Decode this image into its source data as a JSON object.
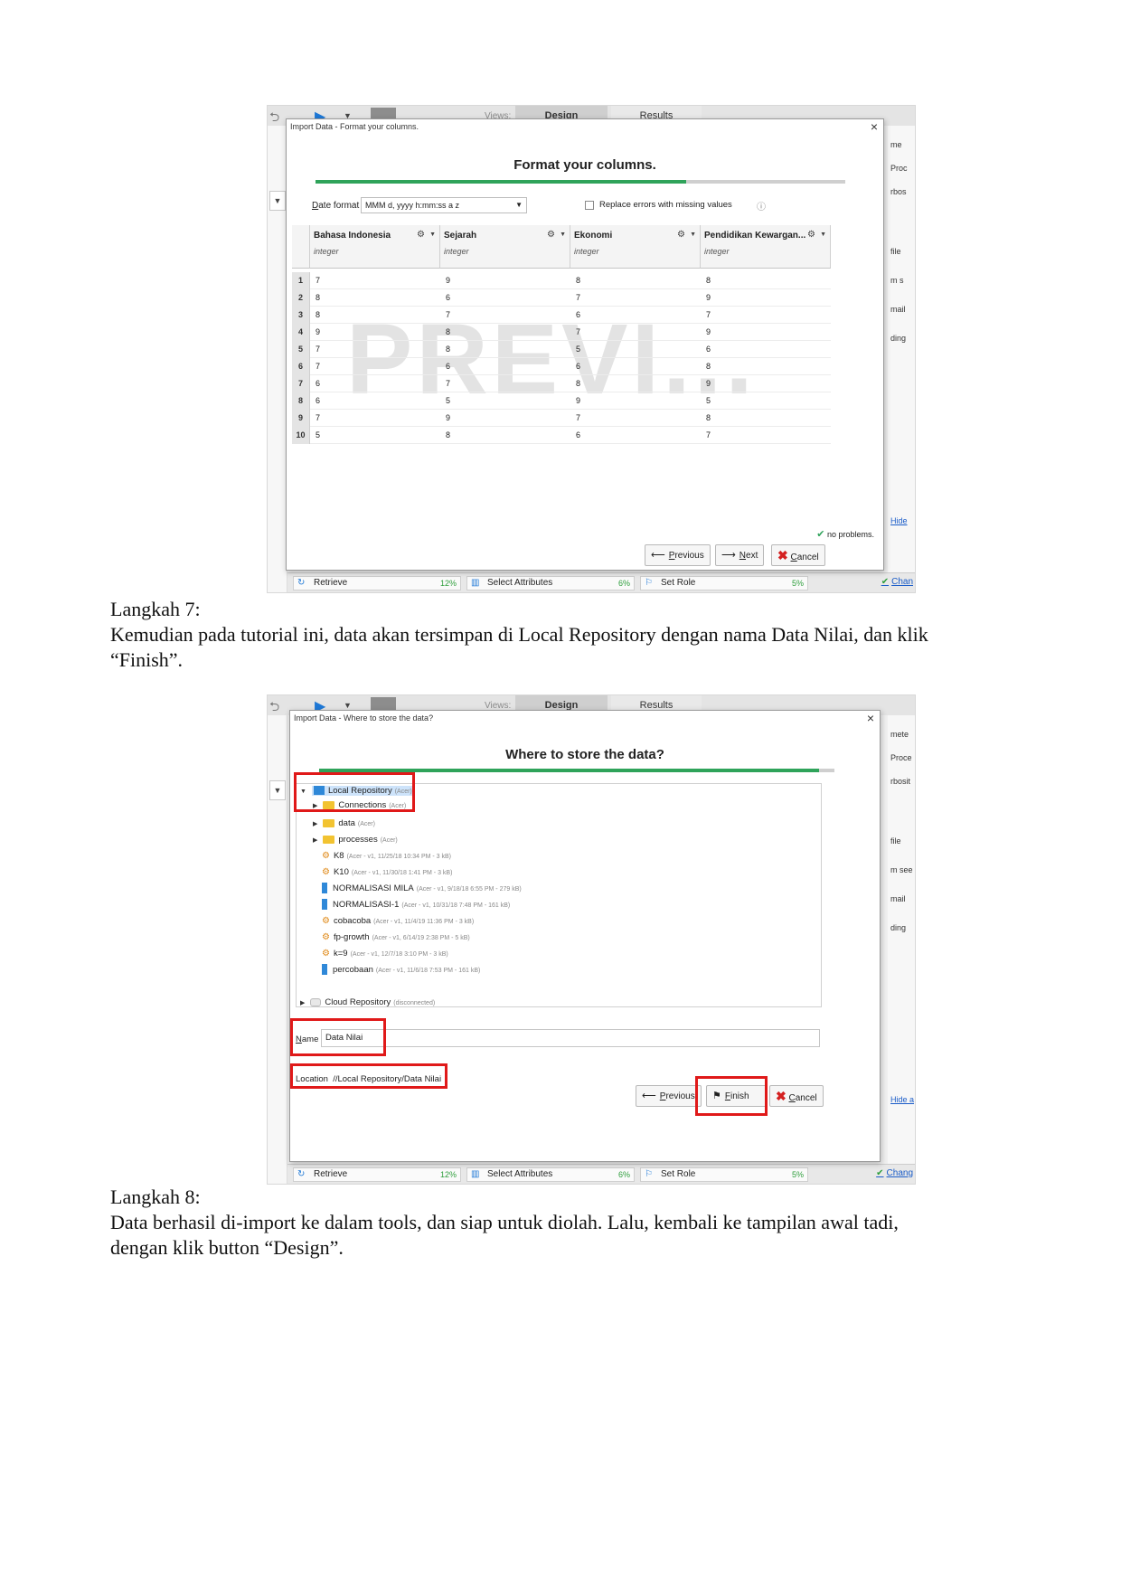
{
  "screenshot1": {
    "bg": {
      "views_label": "Views:",
      "tab_design": "Design",
      "tab_results": "Results",
      "right_fragments": [
        "me",
        "Proc",
        "rbos",
        "file",
        "m s",
        "mail",
        "ding"
      ],
      "hide_link": "Hide",
      "bottom_ops": [
        {
          "label": "Retrieve",
          "pct": "12%"
        },
        {
          "label": "Select Attributes",
          "pct": "6%"
        },
        {
          "label": "Set Role",
          "pct": "5%"
        }
      ],
      "change_link": "Chan"
    },
    "dialog": {
      "title": "Import Data - Format your columns.",
      "heading": "Format your columns.",
      "progress": 0.7,
      "date_format_label": "Date format",
      "date_format_value": "MMM d, yyyy h:mm:ss a z",
      "replace_errors_label": "Replace errors with missing values",
      "columns": [
        {
          "name": "Bahasa Indonesia",
          "type": "integer"
        },
        {
          "name": "Sejarah",
          "type": "integer"
        },
        {
          "name": "Ekonomi",
          "type": "integer"
        },
        {
          "name": "Pendidikan Kewargan...",
          "type": "integer"
        }
      ],
      "rows": [
        {
          "n": "1",
          "v": [
            "7",
            "9",
            "8",
            "8"
          ]
        },
        {
          "n": "2",
          "v": [
            "8",
            "6",
            "7",
            "9"
          ]
        },
        {
          "n": "3",
          "v": [
            "8",
            "7",
            "6",
            "7"
          ]
        },
        {
          "n": "4",
          "v": [
            "9",
            "8",
            "7",
            "9"
          ]
        },
        {
          "n": "5",
          "v": [
            "7",
            "8",
            "5",
            "6"
          ]
        },
        {
          "n": "6",
          "v": [
            "7",
            "6",
            "6",
            "8"
          ]
        },
        {
          "n": "7",
          "v": [
            "6",
            "7",
            "8",
            "9"
          ]
        },
        {
          "n": "8",
          "v": [
            "6",
            "5",
            "9",
            "5"
          ]
        },
        {
          "n": "9",
          "v": [
            "7",
            "9",
            "7",
            "8"
          ]
        },
        {
          "n": "10",
          "v": [
            "5",
            "8",
            "6",
            "7"
          ]
        }
      ],
      "watermark": "PREVI...",
      "status": "no problems.",
      "btn_previous": "Previous",
      "btn_next": "Next",
      "btn_cancel": "Cancel"
    }
  },
  "paragraph1": {
    "heading": "Langkah 7:",
    "line1": "Kemudian pada tutorial ini, data akan tersimpan di Local Repository dengan nama Data Nilai, dan klik",
    "line2": "“Finish”."
  },
  "screenshot2": {
    "bg": {
      "views_label": "Views:",
      "tab_design": "Design",
      "tab_results": "Results",
      "right_fragments": [
        "mete",
        "Proce",
        "rbosit",
        "file",
        "m see",
        "mail",
        "ding"
      ],
      "hide_link": "Hide a",
      "bottom_ops": [
        {
          "label": "Retrieve",
          "pct": "12%"
        },
        {
          "label": "Select Attributes",
          "pct": "6%"
        },
        {
          "label": "Set Role",
          "pct": "5%"
        }
      ],
      "change_link": "Chang"
    },
    "dialog": {
      "title": "Import Data - Where to store the data?",
      "heading": "Where to store the data?",
      "progress": 0.97,
      "tree": {
        "local": {
          "label": "Local Repository",
          "meta": "(Acer)"
        },
        "connections": {
          "label": "Connections",
          "meta": "(Acer)"
        },
        "data": {
          "label": "data",
          "meta": "(Acer)"
        },
        "processes": {
          "label": "processes",
          "meta": "(Acer)"
        },
        "entries": [
          {
            "kind": "process",
            "label": "K8",
            "meta": "(Acer - v1, 11/25/18 10:34 PM - 3 kB)"
          },
          {
            "kind": "process",
            "label": "K10",
            "meta": "(Acer - v1, 11/30/18 1:41 PM - 3 kB)"
          },
          {
            "kind": "data",
            "label": "NORMALISASI MILA",
            "meta": "(Acer - v1, 9/18/18 6:55 PM - 279 kB)"
          },
          {
            "kind": "data",
            "label": "NORMALISASI-1",
            "meta": "(Acer - v1, 10/31/18 7:48 PM - 161 kB)"
          },
          {
            "kind": "process",
            "label": "cobacoba",
            "meta": "(Acer - v1, 11/4/19 11:36 PM - 3 kB)"
          },
          {
            "kind": "process",
            "label": "fp-growth",
            "meta": "(Acer - v1, 6/14/19 2:38 PM - 5 kB)"
          },
          {
            "kind": "process",
            "label": "k=9",
            "meta": "(Acer - v1, 12/7/18 3:10 PM - 3 kB)"
          },
          {
            "kind": "data",
            "label": "percobaan",
            "meta": "(Acer - v1, 11/6/18 7:53 PM - 161 kB)"
          }
        ],
        "cloud": {
          "label": "Cloud Repository",
          "meta": "(disconnected)"
        }
      },
      "name_label": "Name",
      "name_value": "Data Nilai",
      "location_label": "Location",
      "location_value": "//Local Repository/Data Nilai",
      "btn_previous": "Previous",
      "btn_finish": "Finish",
      "btn_cancel": "Cancel"
    }
  },
  "paragraph2": {
    "heading": "Langkah 8:",
    "line1": "Data berhasil di-import ke dalam tools, dan siap untuk diolah. Lalu, kembali ke tampilan awal tadi,",
    "line2": "dengan klik button “Design”."
  },
  "colors": {
    "highlight_red": "#e01919",
    "progress_green": "#2fa35a",
    "link_blue": "#1a5cc8"
  }
}
